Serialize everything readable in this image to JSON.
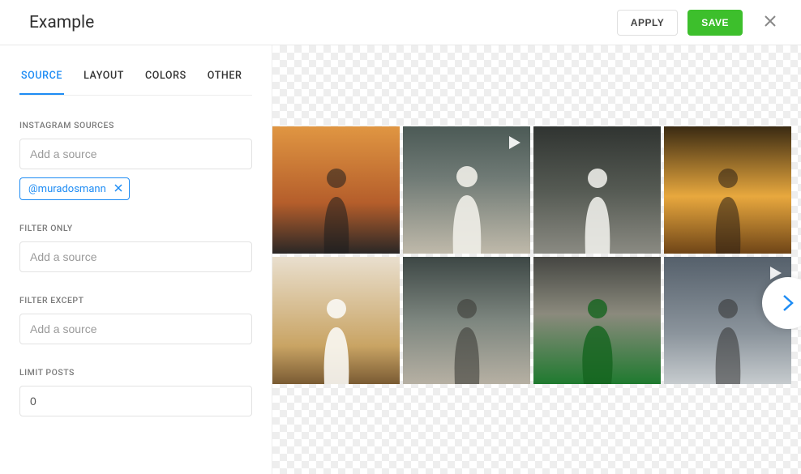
{
  "header": {
    "title": "Example",
    "apply": "APPLY",
    "save": "SAVE"
  },
  "tabs": [
    {
      "label": "SOURCE",
      "active": true
    },
    {
      "label": "LAYOUT",
      "active": false
    },
    {
      "label": "COLORS",
      "active": false
    },
    {
      "label": "OTHER",
      "active": false
    }
  ],
  "fields": {
    "sources_label": "INSTAGRAM SOURCES",
    "sources_placeholder": "Add a source",
    "source_tag": "@muradosmann",
    "filter_only_label": "FILTER ONLY",
    "filter_only_placeholder": "Add a source",
    "filter_except_label": "FILTER EXCEPT",
    "filter_except_placeholder": "Add a source",
    "limit_label": "LIMIT POSTS",
    "limit_value": "0"
  },
  "preview": {
    "thumbs": [
      {
        "is_video": false
      },
      {
        "is_video": true
      },
      {
        "is_video": false
      },
      {
        "is_video": false
      },
      {
        "is_video": false
      },
      {
        "is_video": false
      },
      {
        "is_video": false
      },
      {
        "is_video": true
      }
    ]
  }
}
